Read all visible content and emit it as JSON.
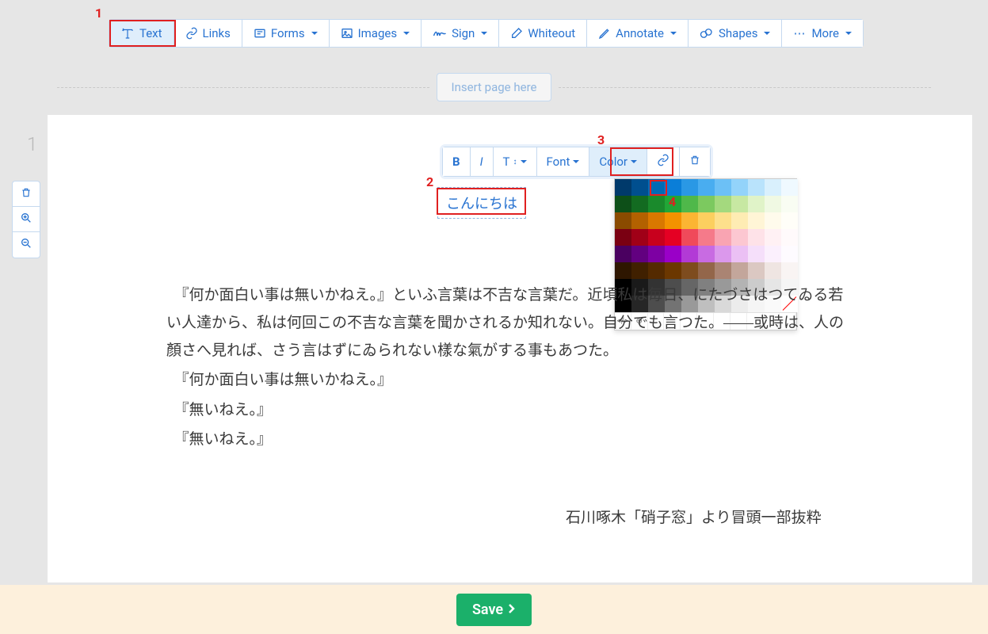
{
  "toolbar": {
    "text": "Text",
    "links": "Links",
    "forms": "Forms",
    "images": "Images",
    "sign": "Sign",
    "whiteout": "Whiteout",
    "annotate": "Annotate",
    "shapes": "Shapes",
    "more": "More"
  },
  "insert_page": "Insert page here",
  "page_number": "1",
  "text_toolbar": {
    "bold": "B",
    "italic": "I",
    "size": "T",
    "font": "Font",
    "color": "Color"
  },
  "text_input_value": "こんにちは",
  "color_picker": {
    "selected": "#0a7ed8",
    "footer": {
      "code": "</>",
      "target": "⊕"
    },
    "rows": [
      [
        "#003a6b",
        "#004f8f",
        "#006bb5",
        "#0a7ed8",
        "#2a98e5",
        "#49adf0",
        "#6cc0f6",
        "#93d3fa",
        "#b9e3fc",
        "#d9f0fd",
        "#eff9ff"
      ],
      [
        "#0d4f18",
        "#136b21",
        "#1a8a2c",
        "#22a637",
        "#4fb84a",
        "#7cc95f",
        "#a4d97e",
        "#c7e8a2",
        "#e0f3c8",
        "#f0f9e3",
        "#f9fdf3"
      ],
      [
        "#8a4b00",
        "#b36100",
        "#d97800",
        "#f39200",
        "#fbb533",
        "#fccf5f",
        "#fde08c",
        "#feecb3",
        "#fff5d6",
        "#fffbec",
        "#fffef8"
      ],
      [
        "#7a0012",
        "#a00017",
        "#c8001d",
        "#e50023",
        "#f04a5a",
        "#f57a8a",
        "#f9a4b2",
        "#fcc7d1",
        "#fee2e8",
        "#fff1f4",
        "#fffafb"
      ],
      [
        "#4a0060",
        "#620080",
        "#7d00a3",
        "#9a00c8",
        "#b23ad6",
        "#c86be2",
        "#db98ec",
        "#ebc0f4",
        "#f5dffa",
        "#fbf0fd",
        "#fefbff"
      ],
      [
        "#2e1600",
        "#402000",
        "#542a00",
        "#6b3700",
        "#7e4c1e",
        "#93664a",
        "#aa8473",
        "#c3a69b",
        "#dbc8c2",
        "#efe5e2",
        "#f9f4f3"
      ],
      [
        "#000000",
        "#1a1a1a",
        "#333333",
        "#4d4d4d",
        "#666666",
        "#808080",
        "#999999",
        "#b3b3b3",
        "#cccccc",
        "#e6e6e6",
        "#f5f5f5"
      ],
      [
        "#000000",
        "#262626",
        "#4d4d4d",
        "#737373",
        "#999999",
        "#bfbfbf",
        "#d9d9d9",
        "#ececec",
        "#f5f5f5",
        "#fafafa",
        "none"
      ]
    ]
  },
  "document": {
    "p1": "　『何か面白い事は無いかねえ。』といふ言葉は不吉な言葉だ。近頃私は毎日、にたづさはつてゐる若い人達から、私は何回この不吉な言葉を聞かされるか知れない。自分でも言つた。――或時は、人の顏さへ見れば、さう言はずにゐられない樣な氣がする事もあつた。",
    "p2": "　『何か面白い事は無いかねえ。』",
    "p3": "　『無いねえ。』",
    "p4": "　『無いねえ。』",
    "attribution": "石川啄木「硝子窓」より冒頭一部抜粋"
  },
  "save_label": "Save",
  "callouts": {
    "c1": "1",
    "c2": "2",
    "c3": "3",
    "c4": "4"
  }
}
